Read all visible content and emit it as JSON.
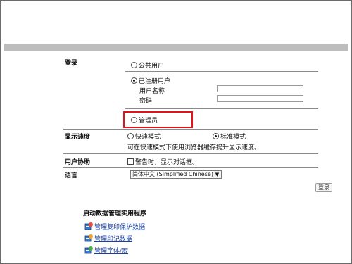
{
  "login": {
    "section_label": "登录",
    "public_user": "公共用户",
    "registered_user": "已注册用户",
    "username_label": "用户名称",
    "username_value": "",
    "password_label": "密码",
    "password_value": "",
    "administrator": "管理员",
    "selected": "registered_user"
  },
  "display_speed": {
    "label": "显示速度",
    "fast_mode": "快速模式",
    "standard_mode": "标准模式",
    "note": "可在快速模式下使用浏览器缓存提升显示速度。",
    "selected": "standard_mode"
  },
  "user_assist": {
    "label": "用户协助",
    "warning_option": "警告时，显示对话框。",
    "checked": false
  },
  "language": {
    "label": "语言",
    "selected": "简体中文 (Simplified Chinese)"
  },
  "login_button": "登录",
  "utilities": {
    "title": "启动数据管理实用程序",
    "items": [
      {
        "label": "管理复印保护数据",
        "icon": "copy-protect-icon"
      },
      {
        "label": "管理印记数据",
        "icon": "stamp-icon"
      },
      {
        "label": "管理字体/宏",
        "icon": "font-macro-icon"
      }
    ]
  },
  "colors": {
    "highlight": "#e0141a",
    "link": "#1a3fa0",
    "header_bar": "#bdbdbd"
  }
}
